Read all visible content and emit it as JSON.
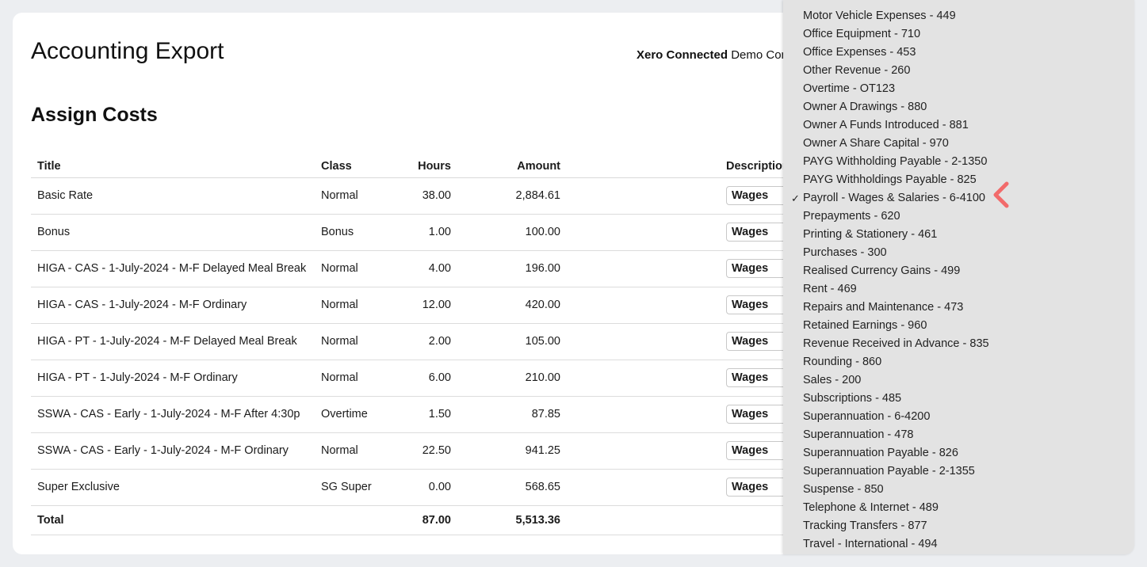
{
  "page": {
    "title": "Accounting Export",
    "connection_label": "Xero Connected",
    "connection_org": "Demo Com"
  },
  "section": {
    "title": "Assign Costs"
  },
  "table": {
    "headers": {
      "title": "Title",
      "class": "Class",
      "hours": "Hours",
      "amount": "Amount",
      "description": "Description"
    },
    "rows": [
      {
        "title": "Basic Rate",
        "class": "Normal",
        "hours": "38.00",
        "amount": "2,884.61",
        "description": "Wages"
      },
      {
        "title": "Bonus",
        "class": "Bonus",
        "hours": "1.00",
        "amount": "100.00",
        "description": "Wages"
      },
      {
        "title": "HIGA - CAS - 1-July-2024 - M-F Delayed Meal Break",
        "class": "Normal",
        "hours": "4.00",
        "amount": "196.00",
        "description": "Wages"
      },
      {
        "title": "HIGA - CAS - 1-July-2024 - M-F Ordinary",
        "class": "Normal",
        "hours": "12.00",
        "amount": "420.00",
        "description": "Wages"
      },
      {
        "title": "HIGA - PT - 1-July-2024 - M-F Delayed Meal Break",
        "class": "Normal",
        "hours": "2.00",
        "amount": "105.00",
        "description": "Wages"
      },
      {
        "title": "HIGA - PT - 1-July-2024 - M-F Ordinary",
        "class": "Normal",
        "hours": "6.00",
        "amount": "210.00",
        "description": "Wages"
      },
      {
        "title": "SSWA - CAS - Early - 1-July-2024 - M-F After 4:30p",
        "class": "Overtime",
        "hours": "1.50",
        "amount": "87.85",
        "description": "Wages"
      },
      {
        "title": "SSWA - CAS - Early - 1-July-2024 - M-F Ordinary",
        "class": "Normal",
        "hours": "22.50",
        "amount": "941.25",
        "description": "Wages"
      },
      {
        "title": "Super Exclusive",
        "class": "SG Super",
        "hours": "0.00",
        "amount": "568.65",
        "description": "Wages"
      }
    ],
    "total": {
      "label": "Total",
      "hours": "87.00",
      "amount": "5,513.36"
    }
  },
  "dropdown": {
    "selected_index": 10,
    "check_mark": "✓",
    "options": [
      "Motor Vehicle Expenses - 449",
      "Office Equipment - 710",
      "Office Expenses - 453",
      "Other Revenue - 260",
      "Overtime - OT123",
      "Owner A Drawings - 880",
      "Owner A Funds Introduced - 881",
      "Owner A Share Capital - 970",
      "PAYG Withholding Payable - 2-1350",
      "PAYG Withholdings Payable - 825",
      "Payroll - Wages & Salaries - 6-4100",
      "Prepayments - 620",
      "Printing & Stationery - 461",
      "Purchases - 300",
      "Realised Currency Gains - 499",
      "Rent - 469",
      "Repairs and Maintenance - 473",
      "Retained Earnings - 960",
      "Revenue Received in Advance - 835",
      "Rounding - 860",
      "Sales - 200",
      "Subscriptions - 485",
      "Superannuation - 6-4200",
      "Superannuation - 478",
      "Superannuation Payable - 826",
      "Superannuation Payable - 2-1355",
      "Suspense - 850",
      "Telephone & Internet - 489",
      "Tracking Transfers - 877",
      "Travel - International - 494"
    ]
  },
  "colors": {
    "annotation_arrow": "#f26b6b",
    "dropdown_bg": "#e3e3e3"
  },
  "icons": {
    "annotation": "chevron-left-icon",
    "selected": "checkmark-icon"
  }
}
